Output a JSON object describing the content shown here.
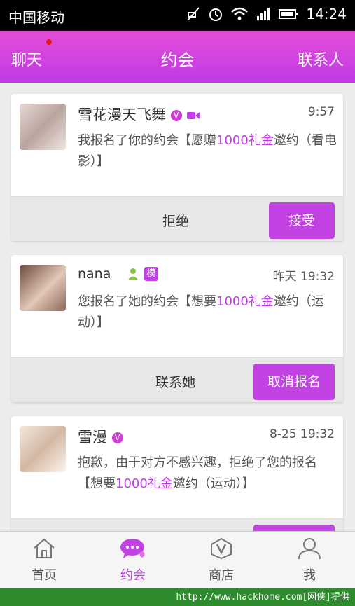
{
  "status_bar": {
    "carrier": "中国移动",
    "time": "14:24"
  },
  "header": {
    "left_tab": "聊天",
    "title": "约会",
    "right_tab": "联系人"
  },
  "cards": [
    {
      "name": "雪花漫天飞舞",
      "badges": [
        "v-badge",
        "video-icon"
      ],
      "time": "9:57",
      "msg_before": "我报名了你的约会【愿赠",
      "msg_highlight": "1000礼金",
      "msg_after": "邀约（看电影）】",
      "secondary_action": "拒绝",
      "primary_action": "接受"
    },
    {
      "name": "nana",
      "badges": [
        "user-icon",
        "model-badge"
      ],
      "badge_text": "模",
      "time": "昨天  19:32",
      "msg_before": "您报名了她的约会【想要",
      "msg_highlight": "1000礼金",
      "msg_after": "邀约（运动）】",
      "secondary_action": "联系她",
      "primary_action": "取消报名"
    },
    {
      "name": "雪漫",
      "badges": [
        "v-badge"
      ],
      "time": "8-25  19:32",
      "msg_before": "抱歉，由于对方不感兴趣，拒绝了您的报名【想要",
      "msg_highlight": "1000礼金",
      "msg_after": "邀约（运动）】"
    }
  ],
  "bottom_nav": [
    {
      "label": "首页",
      "icon": "home-icon",
      "active": false
    },
    {
      "label": "约会",
      "icon": "chat-icon",
      "active": true
    },
    {
      "label": "商店",
      "icon": "shop-v-icon",
      "active": false
    },
    {
      "label": "我",
      "icon": "person-icon",
      "active": false
    }
  ],
  "watermark": "http://www.hackhome.com[网侠]提供",
  "colors": {
    "accent": "#c242e3",
    "header_top": "#e44ed5",
    "header_bottom": "#c13ae9"
  }
}
